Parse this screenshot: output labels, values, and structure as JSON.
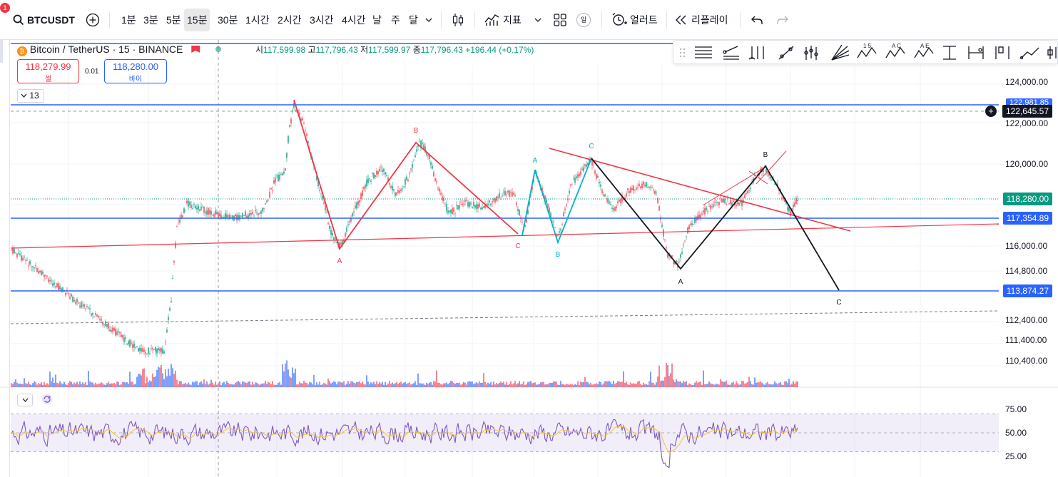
{
  "notification_count": "1",
  "symbol_search": "BTCUSDT",
  "timeframes": [
    "1분",
    "3분",
    "5분",
    "15분",
    "30분",
    "1시간",
    "2시간",
    "3시간",
    "4시간",
    "날",
    "주",
    "달"
  ],
  "active_timeframe": "15분",
  "toolbar": {
    "indicators_label": "지표",
    "templates_badge": "일",
    "alert_label": "얼러트",
    "replay_label": "리플레이"
  },
  "legend": {
    "title": "Bitcoin / TetherUS · 15 · BINANCE",
    "open_label": "시",
    "open": "117,599.98",
    "high_label": "고",
    "high": "117,796.43",
    "low_label": "저",
    "low": "117,599.97",
    "close_label": "종",
    "close": "117,796.43",
    "change": "+196.44 (+0.17%)"
  },
  "trade": {
    "sell_price": "118,279.99",
    "sell_label": "셀",
    "spread": "0.01",
    "buy_price": "118,280.00",
    "buy_label": "바이"
  },
  "indicator_count": "13",
  "price_axis": {
    "ticks": [
      "124,000.00",
      "122,000.00",
      "120,000.00",
      "116,000.00",
      "114,800.00",
      "112,400.00",
      "111,400.00",
      "110,400.00"
    ],
    "tick_values": [
      124000,
      122000,
      120000,
      116000,
      114800,
      112400,
      111400,
      110400
    ],
    "labels": {
      "crosshair": "122,645.57",
      "top_line": "122,981.85",
      "last_price": "118,280.00",
      "mid_line": "117,354.89",
      "low_line": "113,874.27"
    }
  },
  "rsi_axis": {
    "ticks": [
      "75.00",
      "50.00",
      "25.00"
    ],
    "tick_values": [
      75,
      50,
      25
    ]
  },
  "wave_labels": [
    {
      "text": "B",
      "color": "#f23645"
    },
    {
      "text": "A",
      "color": "#f23645"
    },
    {
      "text": "C",
      "color": "#f23645"
    },
    {
      "text": "A",
      "color": "#00b3c7"
    },
    {
      "text": "B",
      "color": "#00b3c7"
    },
    {
      "text": "C",
      "color": "#00b3c7"
    },
    {
      "text": "A",
      "color": "#131722"
    },
    {
      "text": "B",
      "color": "#131722"
    },
    {
      "text": "C",
      "color": "#131722"
    }
  ],
  "colors": {
    "up": "#089981",
    "down": "#f23645",
    "blue_line": "#2962ff",
    "pattern_red": "#f23645",
    "pattern_black": "#131722",
    "rsi": "#7e57c2",
    "rsi_ma": "#f5c32c"
  }
}
